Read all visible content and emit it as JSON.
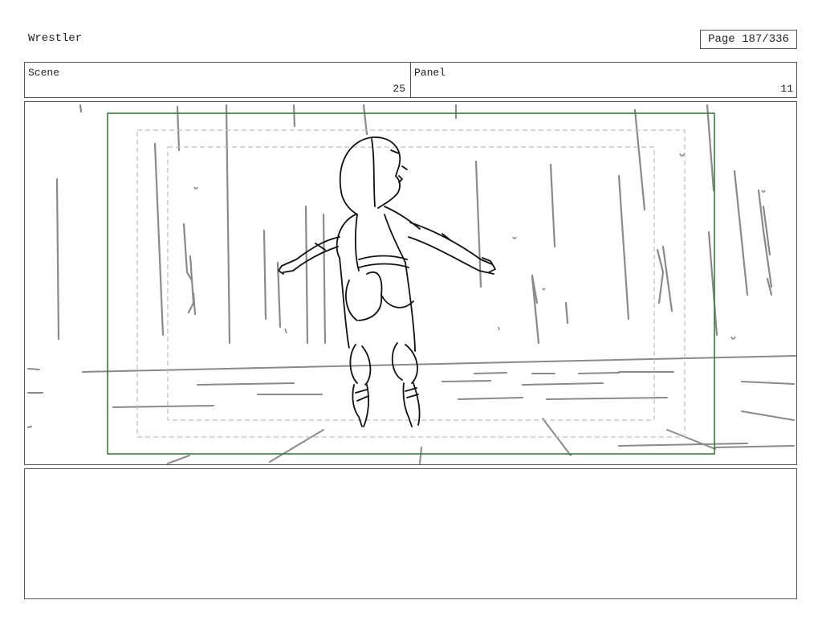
{
  "header": {
    "title": "Wrestler",
    "page_label": "Page 187/336"
  },
  "info": {
    "scene_label": "Scene",
    "scene_value": "25",
    "panel_label": "Panel",
    "panel_value": "11"
  },
  "notes": {
    "text": ""
  }
}
